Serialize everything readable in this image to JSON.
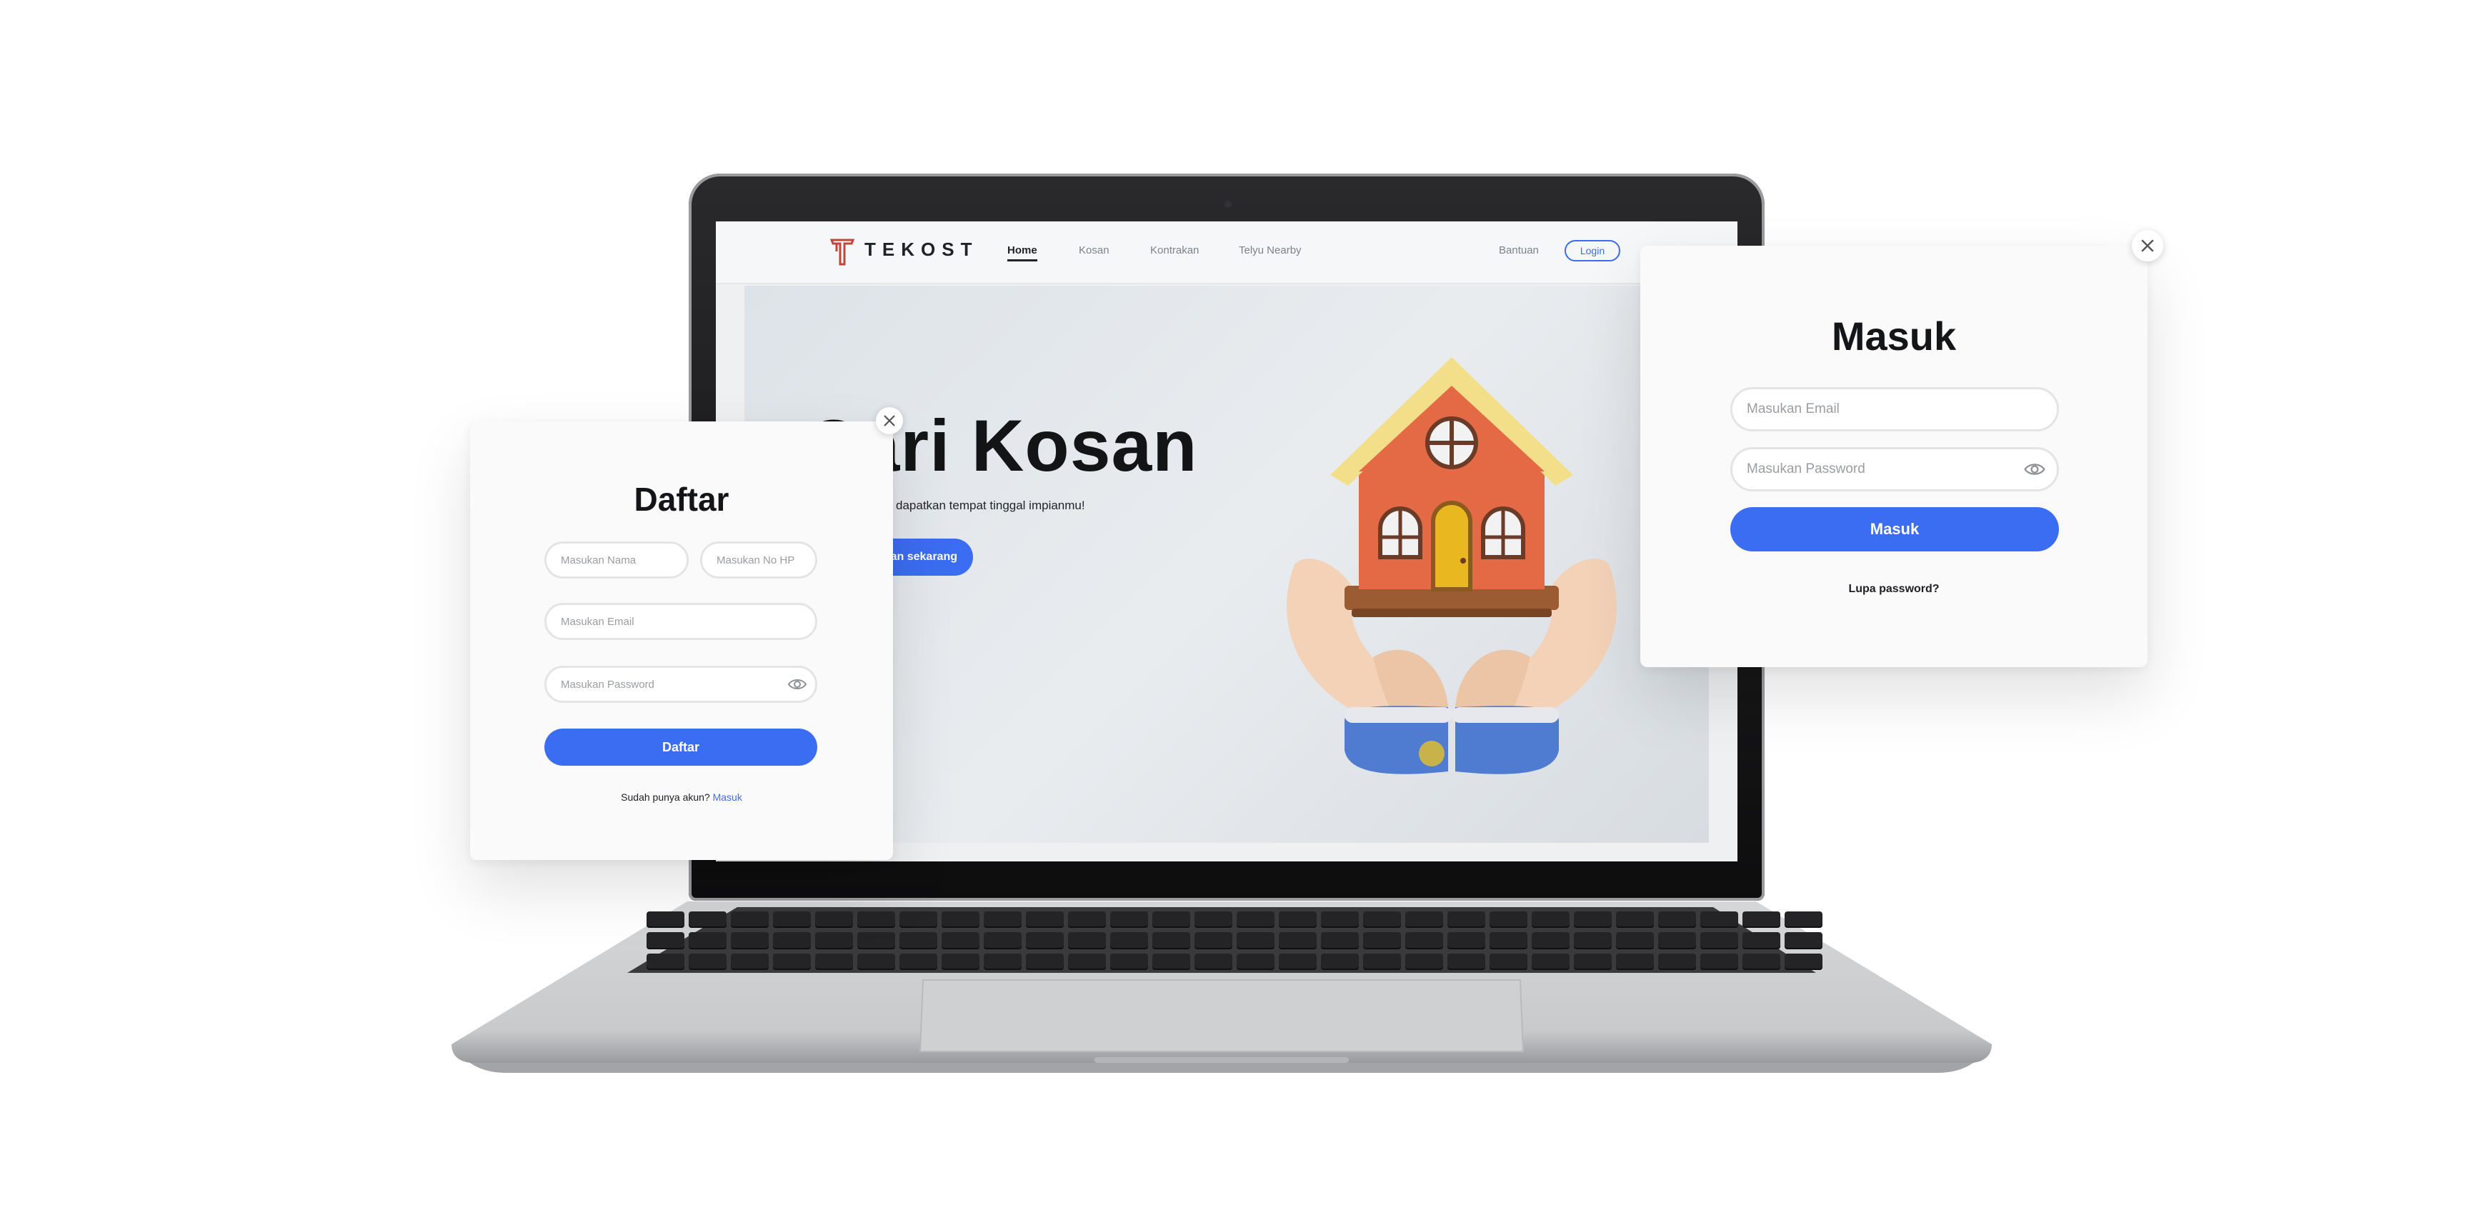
{
  "screen": {
    "brand": "TEKOST",
    "nav": [
      "Home",
      "Kosan",
      "Kontrakan",
      "Telyu Nearby"
    ],
    "help_label": "Bantuan",
    "login_label": "Login",
    "hero_title": "Cari Kosan",
    "hero_subtitle": "dapatkan tempat tinggal impianmu!",
    "hero_cta": "an sekarang"
  },
  "register": {
    "title": "Daftar",
    "name_placeholder": "Masukan Nama",
    "phone_placeholder": "Masukan No HP",
    "email_placeholder": "Masukan Email",
    "password_placeholder": "Masukan Password",
    "submit_label": "Daftar",
    "have_account": "Sudah punya akun?",
    "login_link": "Masuk"
  },
  "login": {
    "title": "Masuk",
    "email_placeholder": "Masukan Email",
    "password_placeholder": "Masukan Password",
    "submit_label": "Masuk",
    "forgot_label": "Lupa password?"
  },
  "colors": {
    "accent": "#3b6df2",
    "background": "#ffffff",
    "modal": "#fafafa"
  },
  "icons": [
    "close-icon",
    "eye-icon",
    "tekost-logo-icon",
    "house-illustration"
  ]
}
